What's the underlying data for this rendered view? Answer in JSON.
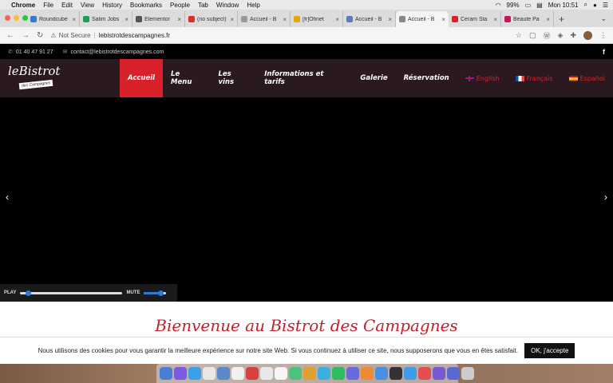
{
  "menubar": {
    "app": "Chrome",
    "items": [
      "File",
      "Edit",
      "View",
      "History",
      "Bookmarks",
      "People",
      "Tab",
      "Window",
      "Help"
    ],
    "battery": "99%",
    "clock": "Mon 10:51"
  },
  "tabs": [
    {
      "title": "Roundcube",
      "color": "#3a78c9"
    },
    {
      "title": "Salim Jobs",
      "color": "#1f9d55"
    },
    {
      "title": "Elementor",
      "color": "#555555"
    },
    {
      "title": "(no subject)",
      "color": "#d93025"
    },
    {
      "title": "Accueil - B",
      "color": "#999999"
    },
    {
      "title": "[fr]Ofinet",
      "color": "#e0a800"
    },
    {
      "title": "Accueil - B",
      "color": "#5b7fb5"
    },
    {
      "title": "Accueil - B",
      "color": "#888888",
      "active": true
    },
    {
      "title": "Ceram Sta",
      "color": "#d9212b"
    },
    {
      "title": "Beaute Pa",
      "color": "#c2185b"
    }
  ],
  "address": {
    "security": "Not Secure",
    "url": "lebistrotdescampagnes.fr"
  },
  "topbar": {
    "phone": "01 40 47 91 27",
    "email": "contact@lebistrotdescampagnes.com",
    "social": "f"
  },
  "logo": {
    "main": "leBistrot",
    "sub": "des Campagnes"
  },
  "nav": {
    "items": [
      "Accueil",
      "Le Menu",
      "Les vins",
      "Informations et tarifs",
      "Galerie",
      "Réservation"
    ],
    "languages": [
      "English",
      "Français",
      "Español"
    ]
  },
  "video": {
    "play_label": "PLAY",
    "mute_label": "MUTE",
    "progress": 0.05,
    "volume": 0.85
  },
  "welcome": {
    "title": "Bienvenue au Bistrot des Campagnes"
  },
  "cookie": {
    "text": "Nous utilisons des cookies pour vous garantir la meilleure expérience sur notre site Web. Si vous continuez à utiliser ce site, nous supposerons que vous en êtes satisfait.",
    "accept": "OK, j'accepte"
  },
  "colors": {
    "accent": "#d9212b",
    "nav_bg": "#2a1a1f"
  }
}
